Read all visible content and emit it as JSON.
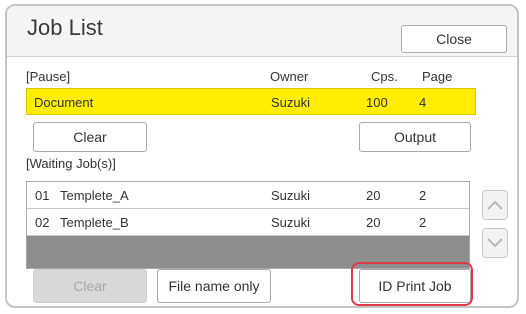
{
  "header": {
    "title": "Job List",
    "close_label": "Close"
  },
  "pause": {
    "section_label": "[Pause]",
    "columns": {
      "owner": "Owner",
      "copies": "Cps.",
      "page": "Page"
    },
    "job": {
      "name": "Document",
      "owner": "Suzuki",
      "copies": "100",
      "page": "4"
    },
    "clear_label": "Clear",
    "output_label": "Output"
  },
  "waiting": {
    "section_label": "[Waiting Job(s)]",
    "jobs": [
      {
        "num": "01",
        "name": "Templete_A",
        "owner": "Suzuki",
        "copies": "20",
        "page": "2"
      },
      {
        "num": "02",
        "name": "Templete_B",
        "owner": "Suzuki",
        "copies": "20",
        "page": "2"
      }
    ],
    "scroll_up_icon": "chevron-up-icon",
    "scroll_down_icon": "chevron-down-icon"
  },
  "footer": {
    "clear_label": "Clear",
    "file_name_only_label": "File name only",
    "id_print_job_label": "ID Print Job"
  },
  "colors": {
    "paused_highlight": "#ffee00",
    "callout": "#e03a4a"
  }
}
